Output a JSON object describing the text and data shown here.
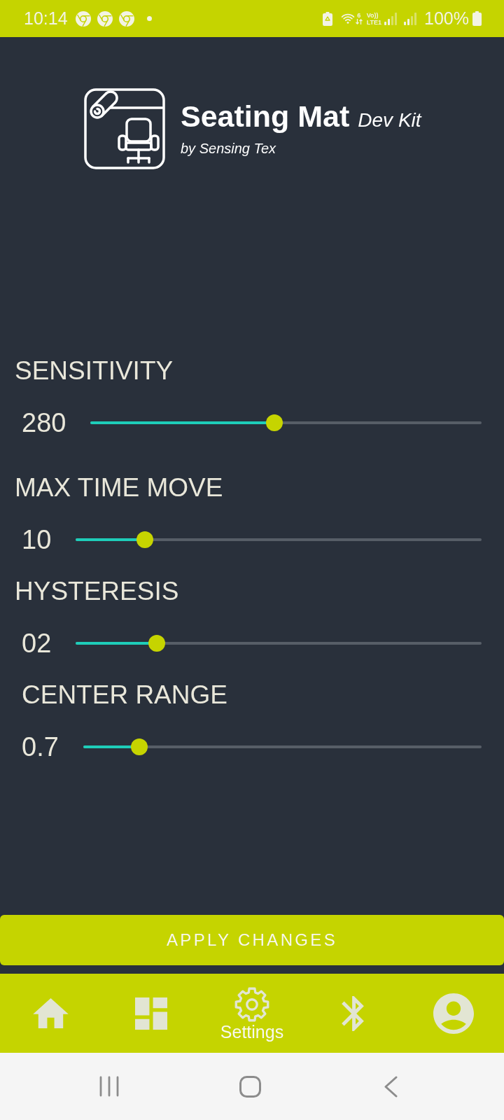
{
  "status_bar": {
    "time": "10:14",
    "wifi_standard": "6",
    "network_top": "Vo))",
    "network_bottom": "LTE1",
    "battery": "100%"
  },
  "logo": {
    "title": "Seating Mat",
    "subtitle": "Dev Kit",
    "byline": "by Sensing Tex"
  },
  "settings": [
    {
      "label": "SENSITIVITY",
      "value": "280",
      "level": 0.47
    },
    {
      "label": "MAX TIME MOVE",
      "value": "10",
      "level": 0.17
    },
    {
      "label": "HYSTERESIS",
      "value": "02",
      "level": 0.2
    },
    {
      "label": "CENTER RANGE",
      "value": "0.7",
      "level": 0.14
    }
  ],
  "apply_button": {
    "label": "APPLY CHANGES"
  },
  "bottom_nav": [
    {
      "kind": "home",
      "selected": false
    },
    {
      "kind": "dashboard",
      "selected": false
    },
    {
      "kind": "settings",
      "label": "Settings",
      "selected": true
    },
    {
      "kind": "bluetooth",
      "selected": false
    },
    {
      "kind": "profile",
      "selected": false
    }
  ]
}
